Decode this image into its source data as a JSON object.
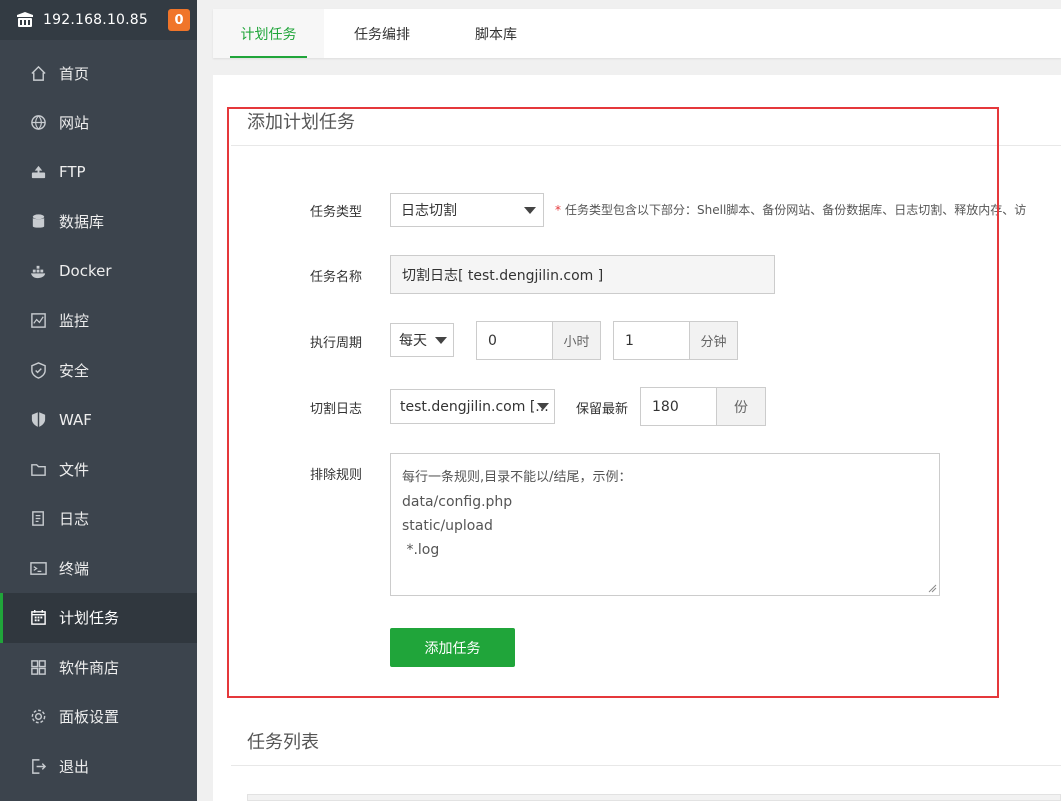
{
  "sidebar": {
    "ip": "192.168.10.85",
    "badge": "0",
    "items": [
      {
        "label": "首页",
        "icon": "home-icon"
      },
      {
        "label": "网站",
        "icon": "globe-icon"
      },
      {
        "label": "FTP",
        "icon": "ftp-icon"
      },
      {
        "label": "数据库",
        "icon": "database-icon"
      },
      {
        "label": "Docker",
        "icon": "docker-icon"
      },
      {
        "label": "监控",
        "icon": "monitor-icon"
      },
      {
        "label": "安全",
        "icon": "shield-icon"
      },
      {
        "label": "WAF",
        "icon": "waf-shield-icon"
      },
      {
        "label": "文件",
        "icon": "folder-icon"
      },
      {
        "label": "日志",
        "icon": "log-icon"
      },
      {
        "label": "终端",
        "icon": "terminal-icon"
      },
      {
        "label": "计划任务",
        "icon": "calendar-icon"
      },
      {
        "label": "软件商店",
        "icon": "apps-grid-icon"
      },
      {
        "label": "面板设置",
        "icon": "gear-icon"
      },
      {
        "label": "退出",
        "icon": "logout-icon"
      }
    ],
    "active_index": 11
  },
  "tabs": [
    "计划任务",
    "任务编排",
    "脚本库"
  ],
  "form": {
    "title": "添加计划任务",
    "task_type_label": "任务类型",
    "task_type_value": "日志切割",
    "task_type_note": "任务类型包含以下部分：Shell脚本、备份网站、备份数据库、日志切割、释放内存、访",
    "task_name_label": "任务名称",
    "task_name_value": "切割日志[ test.dengjilin.com ]",
    "period_label": "执行周期",
    "period_value": "每天",
    "hour_value": "0",
    "hour_unit": "小时",
    "minute_value": "1",
    "minute_unit": "分钟",
    "cut_log_label": "切割日志",
    "cut_log_value": "test.dengjilin.com [...",
    "keep_label": "保留最新",
    "keep_value": "180",
    "keep_unit": "份",
    "exclude_label": "排除规则",
    "exclude_placeholder_lines": [
      "每行一条规则,目录不能以/结尾，示例：",
      "data/config.php",
      "static/upload",
      " *.log"
    ],
    "submit_label": "添加任务"
  },
  "list": {
    "title": "任务列表"
  }
}
